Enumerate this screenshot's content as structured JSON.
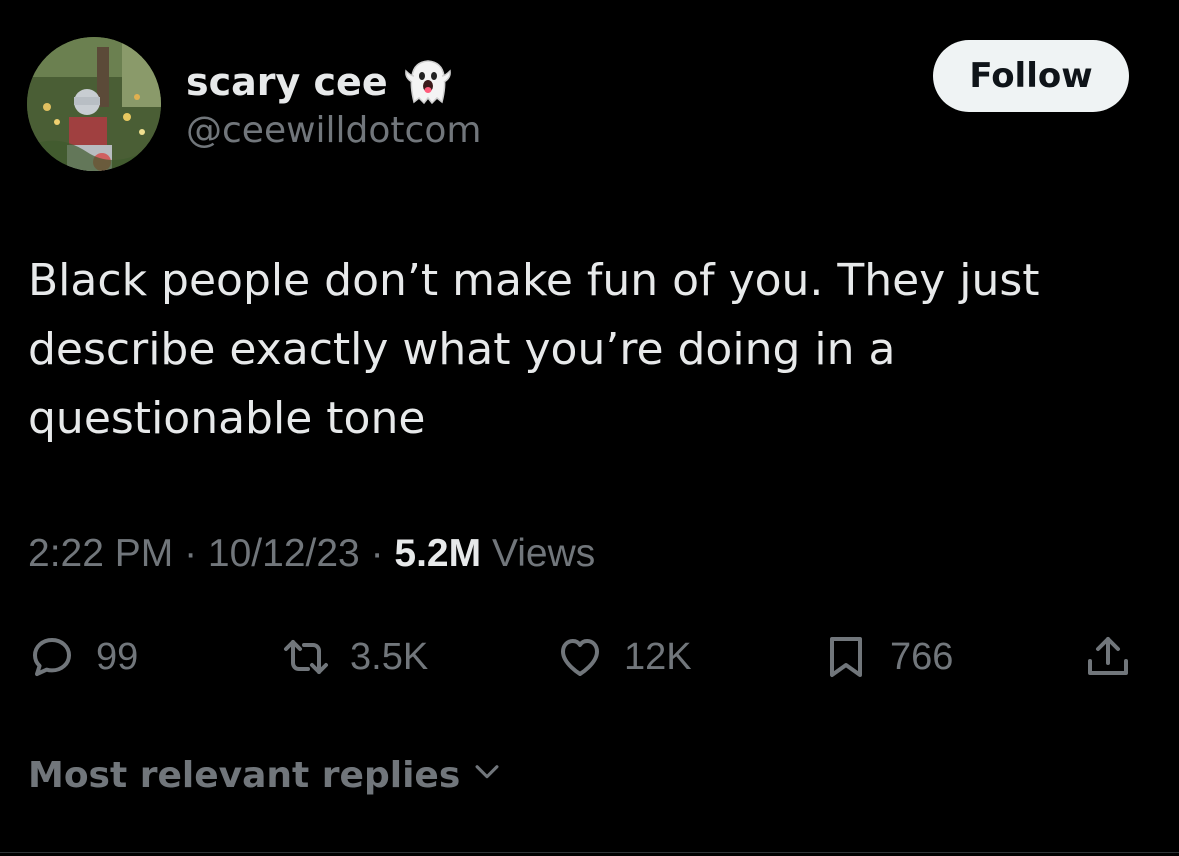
{
  "user": {
    "display_name": "scary cee",
    "name_emoji": "ghost-icon",
    "handle": "@ceewilldotcom",
    "avatar": "avatar"
  },
  "follow_button": {
    "label": "Follow"
  },
  "tweet": {
    "text": "Black people don’t make fun of you. They just describe exactly what you’re doing in a questionable tone"
  },
  "meta": {
    "time": "2:22 PM",
    "separator": " · ",
    "date": "10/12/23",
    "views_count": "5.2M",
    "views_label": " Views"
  },
  "actions": {
    "reply": {
      "icon": "reply-icon",
      "count": "99"
    },
    "retweet": {
      "icon": "retweet-icon",
      "count": "3.5K"
    },
    "like": {
      "icon": "heart-icon",
      "count": "12K"
    },
    "bookmark": {
      "icon": "bookmark-icon",
      "count": "766"
    },
    "share": {
      "icon": "share-icon"
    }
  },
  "replies": {
    "sort_label": "Most relevant replies",
    "icon": "chevron-down-icon"
  },
  "colors": {
    "background": "#000000",
    "text_primary": "#e7e9ea",
    "text_secondary": "#71767b",
    "follow_bg": "#eff3f4"
  }
}
